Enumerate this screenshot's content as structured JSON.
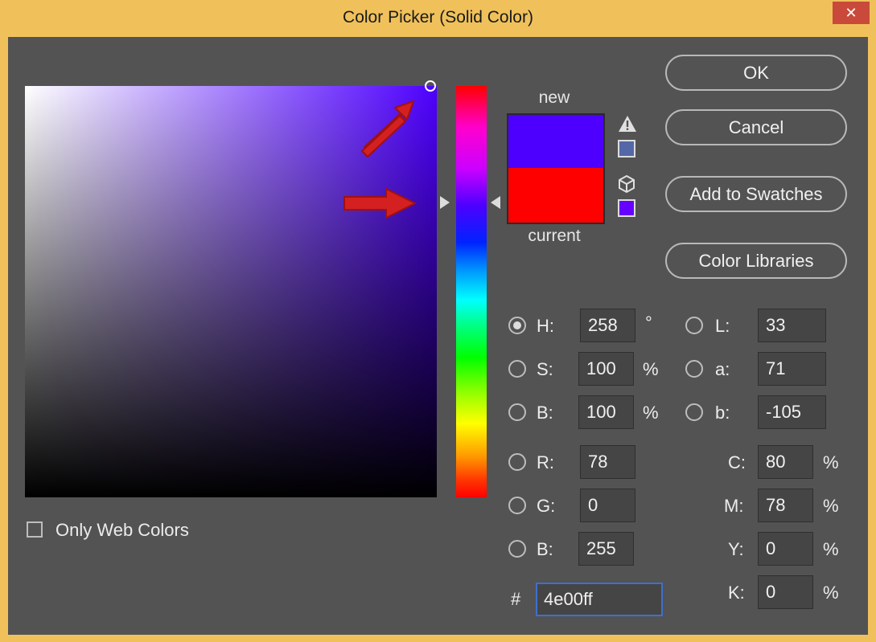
{
  "window": {
    "title": "Color Picker (Solid Color)",
    "close_glyph": "✕"
  },
  "buttons": {
    "ok": "OK",
    "cancel": "Cancel",
    "add_to_swatches": "Add to Swatches",
    "color_libraries": "Color Libraries"
  },
  "preview": {
    "new_label": "new",
    "current_label": "current",
    "new_color": "#4e00ff",
    "current_color": "#ff0000"
  },
  "icons": {
    "warning": "warning-triangle-icon",
    "cube": "cube-icon"
  },
  "hsb": {
    "h": {
      "label": "H:",
      "value": "258",
      "unit": "°",
      "selected": true
    },
    "s": {
      "label": "S:",
      "value": "100",
      "unit": "%"
    },
    "b": {
      "label": "B:",
      "value": "100",
      "unit": "%"
    }
  },
  "lab": {
    "l": {
      "label": "L:",
      "value": "33"
    },
    "a": {
      "label": "a:",
      "value": "71"
    },
    "b": {
      "label": "b:",
      "value": "-105"
    }
  },
  "rgb": {
    "r": {
      "label": "R:",
      "value": "78"
    },
    "g": {
      "label": "G:",
      "value": "0"
    },
    "b": {
      "label": "B:",
      "value": "255"
    }
  },
  "cmyk": {
    "c": {
      "label": "C:",
      "value": "80",
      "unit": "%"
    },
    "m": {
      "label": "M:",
      "value": "78",
      "unit": "%"
    },
    "y": {
      "label": "Y:",
      "value": "0",
      "unit": "%"
    },
    "k": {
      "label": "K:",
      "value": "0",
      "unit": "%"
    }
  },
  "hex": {
    "label": "#",
    "value": "4e00ff"
  },
  "web_colors": {
    "label": "Only Web Colors",
    "checked": false
  },
  "colors": {
    "title_bar": "#f0c15b",
    "dialog_bg": "#535353",
    "accent": "#3f6fcf",
    "annotation_arrow": "#e02020"
  }
}
